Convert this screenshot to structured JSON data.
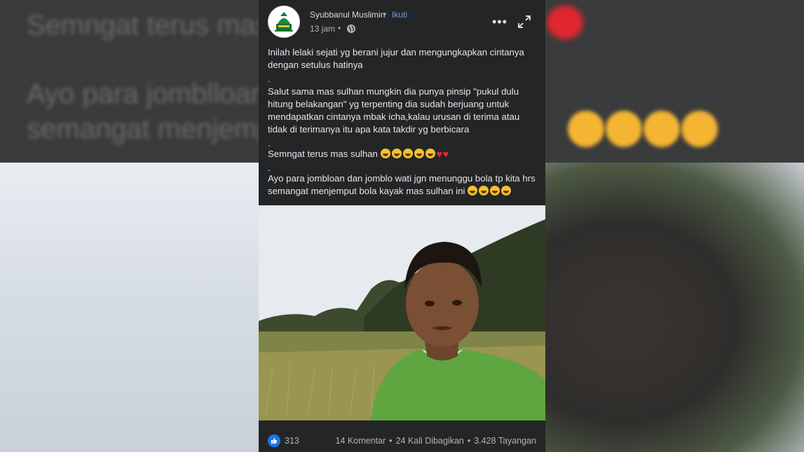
{
  "background": {
    "line1": "Semngat terus mas s",
    "line2": "Ayo para jomblloan d",
    "line3": "semangat menjempu"
  },
  "post": {
    "page_name": "Syubbanul Muslimin",
    "follow_label": "Ikuti",
    "timestamp": "13 jam",
    "paragraphs": [
      "Inilah lelaki sejati yg berani jujur dan mengungkapkan cintanya dengan setulus hatinya",
      ".",
      "Salut sama mas sulhan mungkin dia punya pinsip \"pukul dulu hitung belakangan\" yg terpenting dia sudah berjuang untuk mendapatkan cintanya mbak icha,kalau urusan di terima atau tidak di terimanya itu apa kata takdir yg berbicara",
      ".",
      "Semngat terus mas sulhan",
      ".",
      "Ayo para jombloan dan jomblo wati jgn menunggu bola tp kita hrs semangat menjemput bola kayak mas sulhan ini"
    ],
    "reactions_count": "313",
    "comments": "14 Komentar",
    "shares": "24 Kali Dibagikan",
    "views": "3.428 Tayangan"
  },
  "icons": [
    "globe-icon",
    "more-options-icon",
    "expand-icon",
    "like-icon",
    "emoji-grin",
    "heart"
  ],
  "colors": {
    "card": "#242526",
    "accent": "#1877f2",
    "follow": "#5ea1f4"
  }
}
